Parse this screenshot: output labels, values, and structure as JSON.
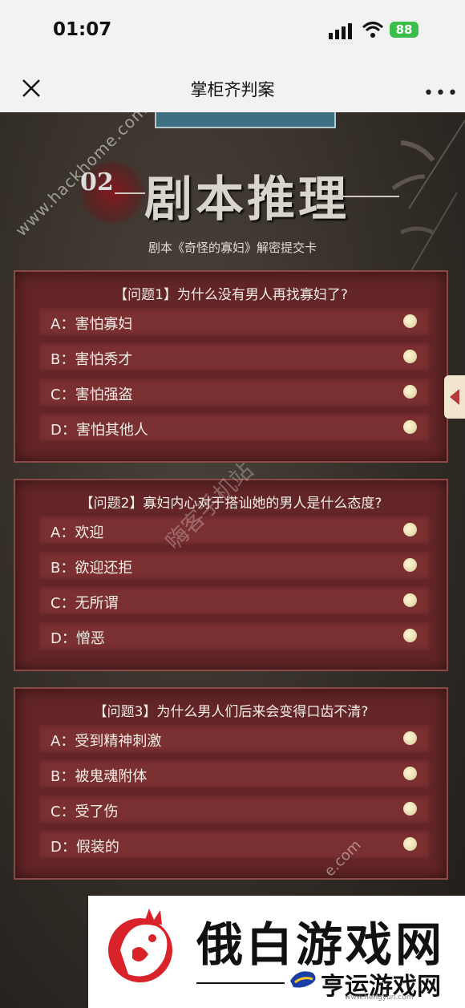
{
  "status": {
    "time": "01:07",
    "battery": "88"
  },
  "nav": {
    "title": "掌柜齐判案",
    "more": "•••"
  },
  "header": {
    "number": "02",
    "title": "剧本推理",
    "subtitle": "剧本《奇怪的寡妇》解密提交卡"
  },
  "questions": [
    {
      "title": "【问题1】为什么没有男人再找寡妇了?",
      "options": [
        "A：害怕寡妇",
        "B：害怕秀才",
        "C：害怕强盗",
        "D：害怕其他人"
      ]
    },
    {
      "title": "【问题2】寡妇内心对于搭讪她的男人是什么态度?",
      "options": [
        "A：欢迎",
        "B：欲迎还拒",
        "C：无所谓",
        "D：憎恶"
      ]
    },
    {
      "title": "【问题3】为什么男人们后来会变得口齿不清?",
      "options": [
        "A：受到精神刺激",
        "B：被鬼魂附体",
        "C：受了伤",
        "D：假装的"
      ]
    }
  ],
  "watermarks": {
    "site": "www.hackhome.com",
    "cn": "嗨客手机站",
    "tail": "e.com"
  },
  "banner": {
    "big": "俄白游戏网",
    "small": "亨运游戏网",
    "url": "www.hengyun.com"
  },
  "colors": {
    "card": "#632527",
    "option": "#7a2f31",
    "accent": "#b33b3b"
  }
}
